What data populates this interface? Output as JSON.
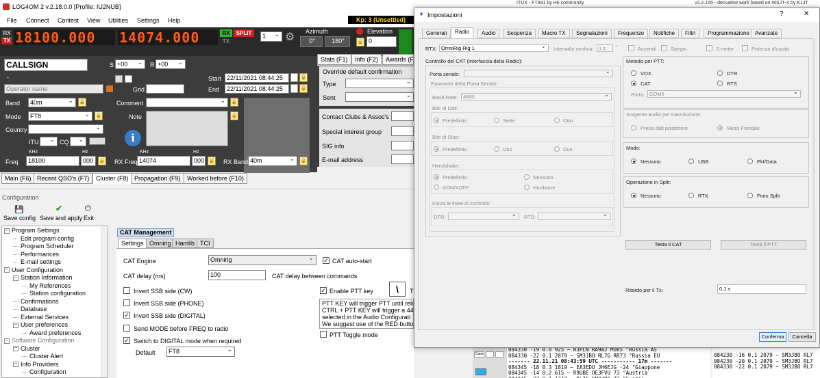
{
  "window": {
    "title": "LOG4OM 2 v.2.18.0.0 [Profile: IU2NUB]",
    "menu": [
      "File",
      "Connect",
      "Contest",
      "View",
      "Utilities",
      "Settings",
      "Help"
    ],
    "kp": "Kp: 3 (Unsettled)"
  },
  "radio": {
    "rx_tag": "RX",
    "tx_tag": "TX",
    "rx_freq": "18100.000",
    "tx_freq": "14074.000",
    "rx_btn": "RX",
    "split_btn": "SPLIT",
    "tx_small": "TX",
    "vfo_value": "1",
    "azimuth_label": "Azimuth",
    "az_value": "0°",
    "az_value2": "180°",
    "elevation_label": "Elevation",
    "elevation_value": "0"
  },
  "qso": {
    "callsign": "CALLSIGN",
    "s_label": "S",
    "s_value": "+00",
    "r_label": "R",
    "r_value": "+00",
    "start_label": "Start",
    "start_value": "22/11/2021 08:44:25",
    "end_label": "End",
    "end_value": "22/11/2021 08:44:25",
    "operator_placeholder": "Operator name",
    "grid_label": "Grid",
    "band_label": "Band",
    "band_value": "40m",
    "comment_label": "Comment",
    "mode_label": "Mode",
    "mode_value": "FT8",
    "note_label": "Note",
    "country_label": "Country",
    "itu_label": "ITU",
    "cq_label": "CQ",
    "khz_label": "KHz",
    "hz_label": "Hz",
    "freq_label": "Freq",
    "freq_khz": "18100",
    "freq_hz": "000",
    "rxfreq_label": "RX Freq",
    "rxfreq_khz": "14074",
    "rxfreq_hz": "000",
    "rxband_label": "RX Band",
    "rxband_value": "40m",
    "dash": "-"
  },
  "right_panel": {
    "tabs": [
      "Stats (F1)",
      "Info (F2)",
      "Awards (F"
    ],
    "override_title": "Override default confirmation",
    "type_label": "Type",
    "sent_label": "Sent",
    "fields": [
      "Contact Clubs & Assoc's",
      "Special interest group",
      "SIG info",
      "E-mail address"
    ]
  },
  "bottom_tabs": [
    "Main (F6)",
    "Recent QSO's (F7)",
    "Cluster (F8)",
    "Propagation (F9)",
    "Worked before (F10)"
  ],
  "config": {
    "title": "Configuration",
    "toolbar": [
      "Save config",
      "Save and apply",
      "Exit"
    ],
    "tree": [
      {
        "label": "Program Settings",
        "level": 0,
        "toggle": "−"
      },
      {
        "label": "Edit program config",
        "level": 1,
        "toggle": ""
      },
      {
        "label": "Program Scheduler",
        "level": 1,
        "toggle": ""
      },
      {
        "label": "Performances",
        "level": 1,
        "toggle": ""
      },
      {
        "label": "E-mail settings",
        "level": 1,
        "toggle": ""
      },
      {
        "label": "User Configuration",
        "level": 0,
        "toggle": "−"
      },
      {
        "label": "Station Information",
        "level": 1,
        "toggle": "−"
      },
      {
        "label": "My References",
        "level": 2,
        "toggle": ""
      },
      {
        "label": "Station configuration",
        "level": 2,
        "toggle": ""
      },
      {
        "label": "Confirmations",
        "level": 1,
        "toggle": ""
      },
      {
        "label": "Database",
        "level": 1,
        "toggle": ""
      },
      {
        "label": "External Services",
        "level": 1,
        "toggle": ""
      },
      {
        "label": "User preferences",
        "level": 1,
        "toggle": "−"
      },
      {
        "label": "Award preferences",
        "level": 2,
        "toggle": ""
      },
      {
        "label": "Software Configuration",
        "level": 0,
        "toggle": "−"
      },
      {
        "label": "Cluster",
        "level": 1,
        "toggle": "−"
      },
      {
        "label": "Cluster Alert",
        "level": 2,
        "toggle": ""
      },
      {
        "label": "Info Providers",
        "level": 1,
        "toggle": "−"
      },
      {
        "label": "Configuration",
        "level": 2,
        "toggle": ""
      }
    ],
    "cat_title": "CAT Management",
    "cat_tabs": [
      "Settings",
      "Omnirig",
      "Hamlib",
      "TCI"
    ],
    "cat_engine_label": "CAT Engine",
    "cat_engine_value": "Omnirig",
    "cat_autostart": "CAT auto-start",
    "cat_delay_label": "CAT delay (ms)",
    "cat_delay_value": "100",
    "cat_delay_between": "CAT delay between commands",
    "checks": [
      {
        "label": "Invert SSB side (CW)",
        "checked": false
      },
      {
        "label": "Invert SSB side (PHONE)",
        "checked": false
      },
      {
        "label": "Invert SSB side (DIGITAL)",
        "checked": true
      },
      {
        "label": "Send MODE before FREQ to radio",
        "checked": false
      },
      {
        "label": "Switch to DIGITAL mode when required",
        "checked": true
      }
    ],
    "default_label": "Default",
    "default_value": "FT8",
    "enable_ptt": "Enable PTT key",
    "ptt_key": "\\",
    "ptt_key_side": "T",
    "ptt_text": [
      "PTT KEY will trigger PTT until rele",
      "CTRL + PTT KEY will trigger a 440",
      "selected in the Audio Configurati",
      "We suggest use of the RED butto"
    ],
    "ptt_toggle": "PTT Toggle mode"
  },
  "cluster": {
    "header_text": "ITDX - FT891 by H6 community",
    "header_right": "v2.2.155 - derivative work based on WSJT-X by K1JT",
    "lines": [
      "084330 -19  0.0  925 ~ R3PLN RA9AJ MO85       °Russia AS",
      "084330 -22  0.1 2079 ~ SM3JBO RL7G RR73       °Russia EU",
      "------- 22.11.21 08:43:59 UTC ----------- 17m -------",
      "084345 -18  0.3 1819 ~ EA3EDU JH6EJG -24      °Giappone",
      "084345 -14  0.2  615 ~ R9UBE OE3FVU 73        °Austria",
      "084345 -22  0.1 1247 ~ RL7G SM3JBO 73         °Svezia"
    ],
    "right_lines": [
      "084230 -16  0.1 2079 ~ SM3JBO RL7",
      "084230 -20  0.1 2079 ~ SM3JBO RL7",
      "084330 -22  0.1 2079 ~ SM3JBO RL7"
    ]
  },
  "dialog": {
    "title": "Impostazioni",
    "help": "?",
    "close": "✕",
    "tabs": [
      "Generali",
      "Radio",
      "Audio",
      "Sequenza",
      "Macro TX",
      "Segnalazioni",
      "Frequenze",
      "Notifiche",
      "Filtri",
      "Programmazione",
      "Avanzate"
    ],
    "rtx_label": "RTX:",
    "rtx_value": "OmniRig Rig 1",
    "poll_label": "Intervallo verifica:",
    "poll_value": "1 s",
    "top_checks": [
      "Accendi",
      "Spegni",
      "S meter",
      "Potenza d'uscita"
    ],
    "cat_section": "Controllo del CAT (interfaccia della Radio):",
    "serial_label": "Porta seriale:",
    "serial_params": "Parametri della Porta Seriale:",
    "baud_label": "Baud Rate:",
    "baud_value": "4800",
    "databits_label": "Bits di Dati:",
    "databits": [
      "Predefinito",
      "Sette",
      "Otto"
    ],
    "stopbits_label": "Bits di Stop:",
    "stopbits": [
      "Predefinito",
      "Uno",
      "Due"
    ],
    "handshake_label": "Handshake:",
    "handshake": [
      "Predefinito",
      "Nessuno",
      "XON/XOFF",
      "Hardware"
    ],
    "force_label": "Forza le linee di controllo:",
    "dtr_label": "DTR:",
    "rts_label": "RTS:",
    "ptt_method_label": "Metodo per PTT:",
    "ptt_methods": [
      "VOX",
      "DTR",
      "CAT",
      "RTS"
    ],
    "port_label": "Porta:",
    "port_value": "COM6",
    "audio_src_label": "Sorgente audio per trasmissione:",
    "audio_src": [
      "Presa dati  posteriore",
      "Micro Frontale"
    ],
    "mode_label": "Modo:",
    "modes": [
      "Nessuno",
      "USB",
      "Pkt/Data"
    ],
    "split_label": "Operazione in Split:",
    "splits": [
      "Nessuno",
      "RTX",
      "Finto Split"
    ],
    "test_cat": "Testa il CAT",
    "test_ptt": "Testa il PTT",
    "tx_delay_label": "Ritardo per il Tx:",
    "tx_delay_value": "0,1 s",
    "ok": "Conferma",
    "cancel": "Cancella"
  }
}
